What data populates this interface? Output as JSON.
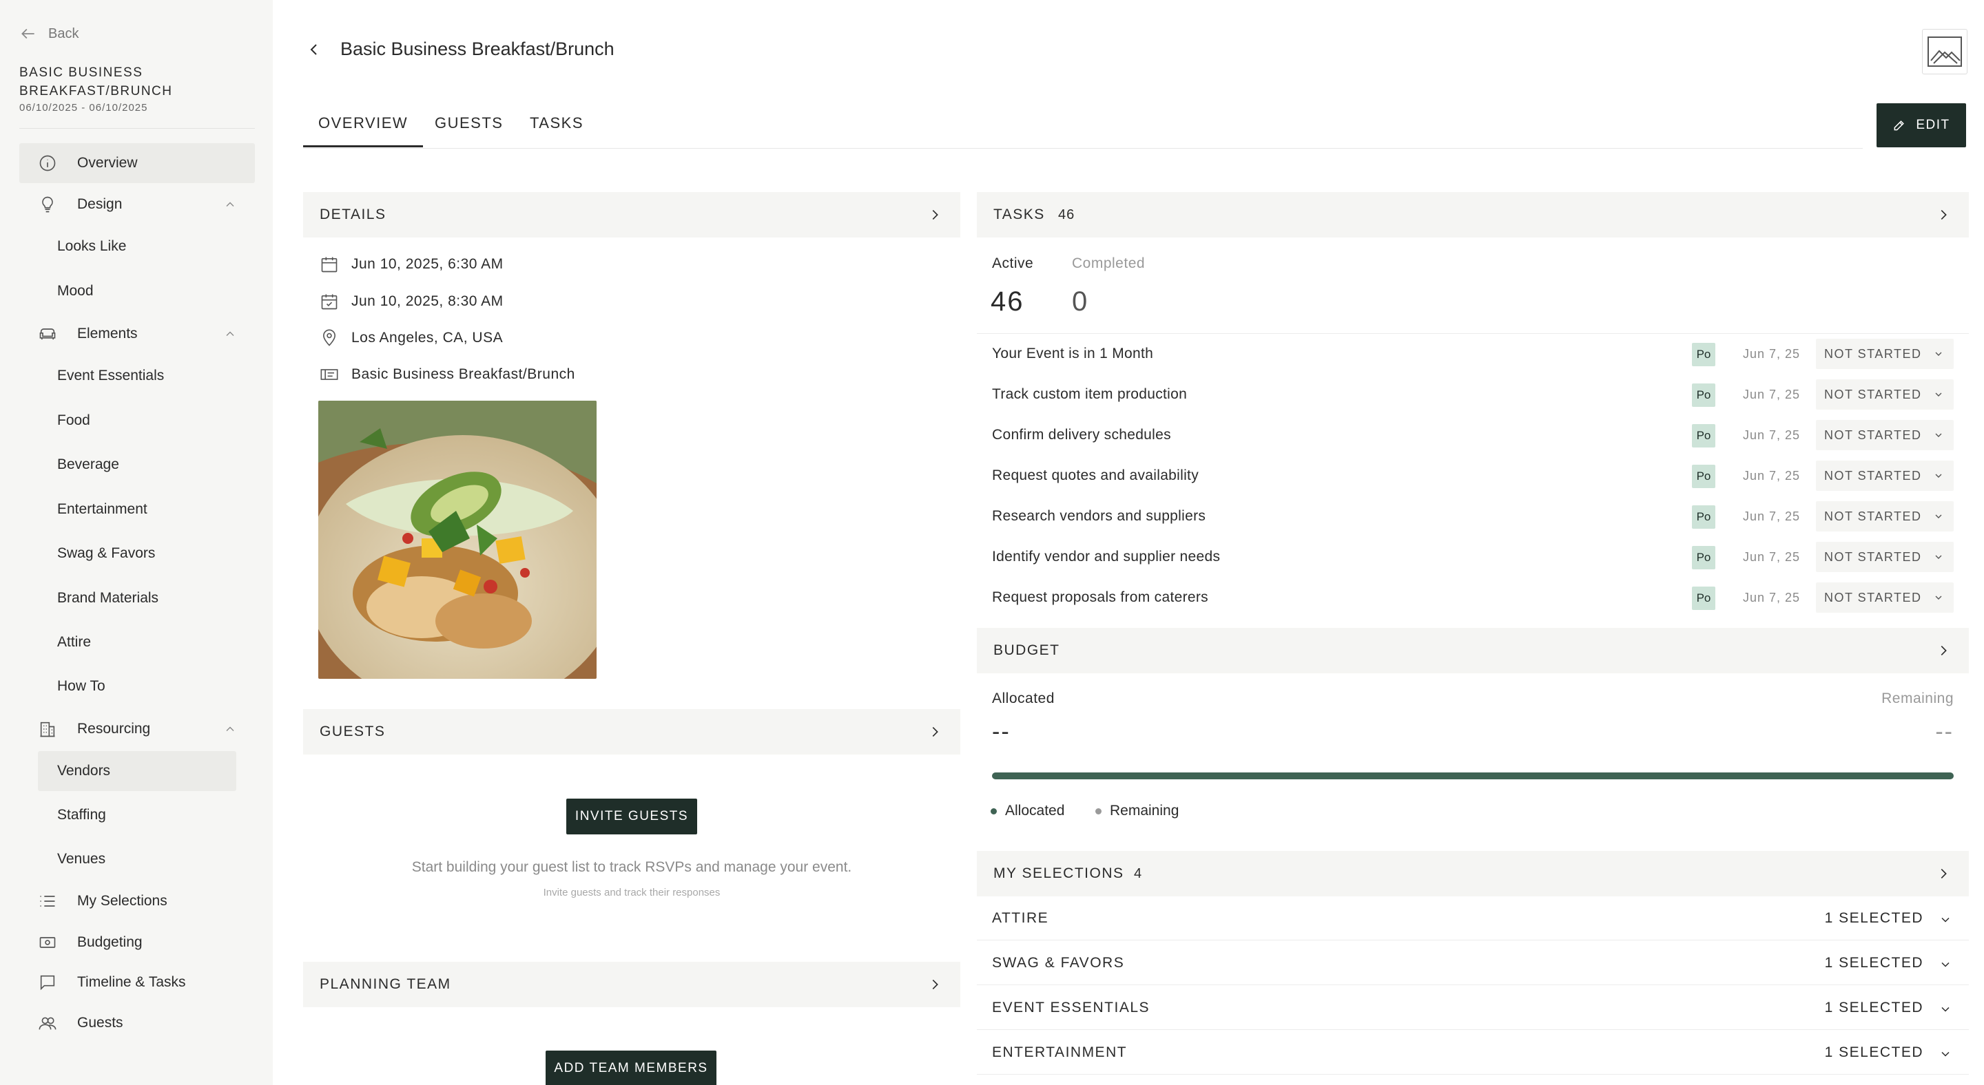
{
  "sidebar": {
    "back_label": "Back",
    "event_name": "BASIC BUSINESS BREAKFAST/BRUNCH",
    "event_dates": "06/10/2025 - 06/10/2025",
    "items": {
      "overview": "Overview",
      "design": "Design",
      "looks_like": "Looks Like",
      "mood": "Mood",
      "elements": "Elements",
      "event_essentials": "Event Essentials",
      "food": "Food",
      "beverage": "Beverage",
      "entertainment": "Entertainment",
      "swag_favors": "Swag & Favors",
      "brand_materials": "Brand Materials",
      "attire": "Attire",
      "how_to": "How To",
      "resourcing": "Resourcing",
      "vendors": "Vendors",
      "staffing": "Staffing",
      "venues": "Venues",
      "my_selections": "My Selections",
      "budgeting": "Budgeting",
      "timeline_tasks": "Timeline & Tasks",
      "guests": "Guests"
    }
  },
  "header": {
    "title": "Basic Business Breakfast/Brunch",
    "tabs": [
      "OVERVIEW",
      "GUESTS",
      "TASKS"
    ],
    "edit_label": "EDIT"
  },
  "details": {
    "title": "DETAILS",
    "start": "Jun 10, 2025, 6:30 AM",
    "end": "Jun 10, 2025, 8:30 AM",
    "location": "Los Angeles, CA, USA",
    "event_type": "Basic Business Breakfast/Brunch"
  },
  "guests": {
    "title": "GUESTS",
    "invite_label": "INVITE GUESTS",
    "message": "Start building your guest list to track RSVPs and manage your event.",
    "sub": "Invite guests and track their responses"
  },
  "planning_team": {
    "title": "PLANNING TEAM",
    "add_label": "ADD TEAM MEMBERS"
  },
  "tasks": {
    "title": "TASKS",
    "count": "46",
    "active_label": "Active",
    "completed_label": "Completed",
    "active_count": "46",
    "completed_count": "0",
    "rows": [
      {
        "name": "Your Event is in 1 Month",
        "assignee": "Po",
        "date": "Jun 7, 25",
        "status": "NOT STARTED"
      },
      {
        "name": "Track custom item production",
        "assignee": "Po",
        "date": "Jun 7, 25",
        "status": "NOT STARTED"
      },
      {
        "name": "Confirm delivery schedules",
        "assignee": "Po",
        "date": "Jun 7, 25",
        "status": "NOT STARTED"
      },
      {
        "name": "Request quotes and availability",
        "assignee": "Po",
        "date": "Jun 7, 25",
        "status": "NOT STARTED"
      },
      {
        "name": "Research vendors and suppliers",
        "assignee": "Po",
        "date": "Jun 7, 25",
        "status": "NOT STARTED"
      },
      {
        "name": "Identify vendor and supplier needs",
        "assignee": "Po",
        "date": "Jun 7, 25",
        "status": "NOT STARTED"
      },
      {
        "name": "Request proposals from caterers",
        "assignee": "Po",
        "date": "Jun 7, 25",
        "status": "NOT STARTED"
      }
    ]
  },
  "budget": {
    "title": "BUDGET",
    "allocated_label": "Allocated",
    "remaining_label": "Remaining",
    "allocated_value": "--",
    "remaining_value": "--",
    "legend_allocated": "Allocated",
    "legend_remaining": "Remaining",
    "bar_color": "#3f6354"
  },
  "selections": {
    "title": "MY SELECTIONS",
    "count": "4",
    "rows": [
      {
        "name": "ATTIRE",
        "count": "1 SELECTED"
      },
      {
        "name": "SWAG & FAVORS",
        "count": "1 SELECTED"
      },
      {
        "name": "EVENT ESSENTIALS",
        "count": "1 SELECTED"
      },
      {
        "name": "ENTERTAINMENT",
        "count": "1 SELECTED"
      }
    ]
  },
  "colors": {
    "accent_dark": "#1f2e29",
    "avatar_bg": "#cde3d8",
    "sidebar_bg": "#f6f6f4"
  }
}
